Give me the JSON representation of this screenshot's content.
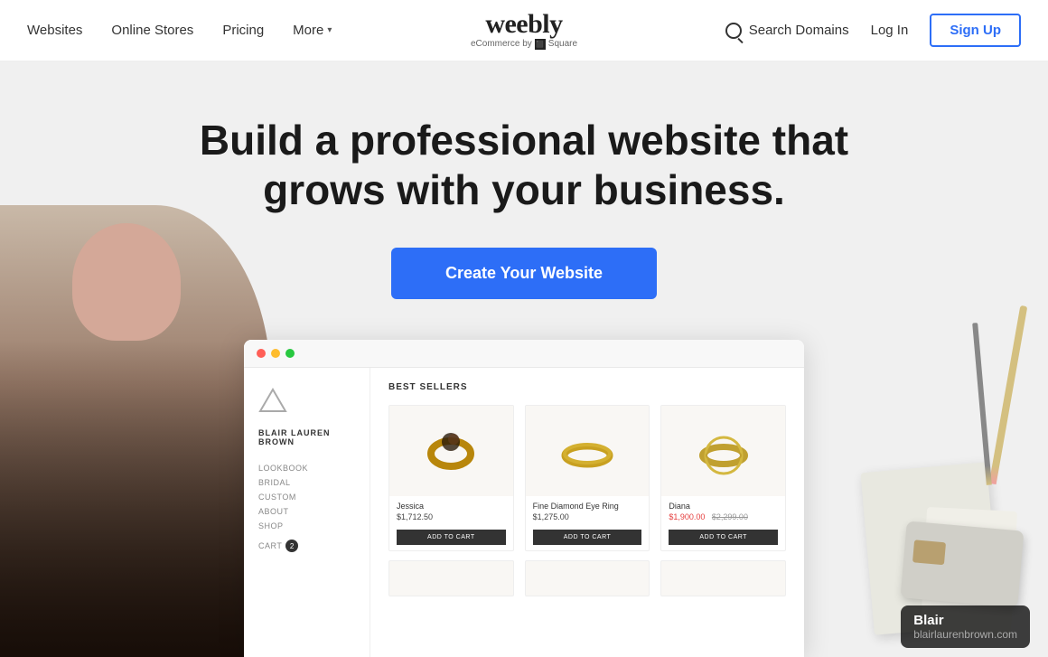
{
  "header": {
    "logo": "weebly",
    "logo_sub": "eCommerce by",
    "logo_square": "⬛",
    "logo_brand": "Square",
    "nav": {
      "websites": "Websites",
      "online_stores": "Online Stores",
      "pricing": "Pricing",
      "more": "More"
    },
    "search_domains": "Search Domains",
    "login": "Log In",
    "signup": "Sign Up"
  },
  "hero": {
    "headline": "Build a professional website that grows with your business.",
    "cta": "Create Your Website"
  },
  "preview": {
    "brand": "BLAIR LAUREN BROWN",
    "nav_items": [
      "LOOKBOOK",
      "BRIDAL",
      "CUSTOM",
      "ABOUT",
      "SHOP"
    ],
    "cart_label": "CART",
    "cart_count": "2",
    "best_sellers_title": "BEST SELLERS",
    "products": [
      {
        "name": "Jessica",
        "price": "$1,712.50",
        "sale_price": null,
        "original_price": null,
        "add_to_cart": "ADD TO CART"
      },
      {
        "name": "Fine Diamond Eye Ring",
        "price": "$1,275.00",
        "sale_price": null,
        "original_price": null,
        "add_to_cart": "ADD TO CART"
      },
      {
        "name": "Diana",
        "price": "$1,900.00",
        "sale_price": "$1,900.00",
        "original_price": "$2,299.00",
        "add_to_cart": "ADD TO CART"
      }
    ]
  },
  "blair_tag": {
    "name": "Blair",
    "url": "blairlaurenbrown.com"
  }
}
